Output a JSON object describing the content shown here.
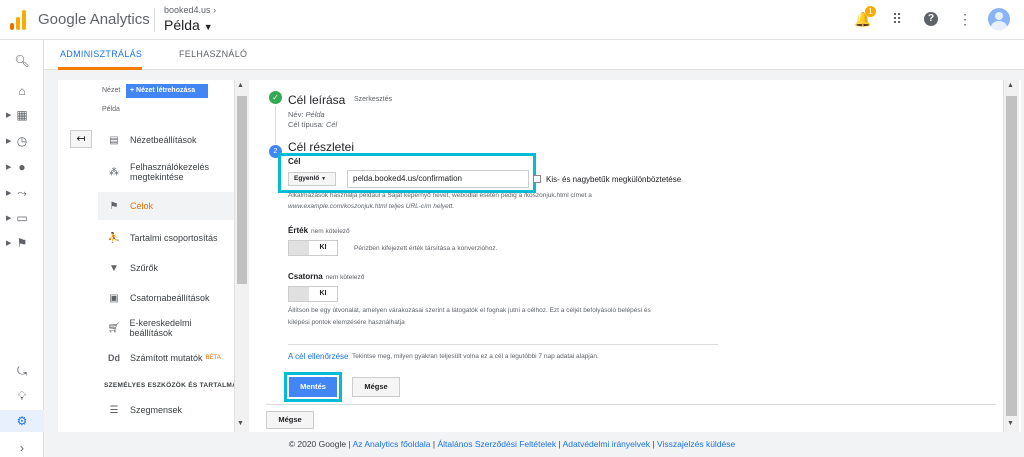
{
  "header": {
    "app_name": "Google Analytics",
    "account_top": "booked4.us",
    "account_main": "Példa",
    "notification_count": "1"
  },
  "rail": {
    "items": [
      "search-icon",
      "home-icon",
      "dashboard-icon",
      "clock-icon",
      "person-icon",
      "acquisition-icon",
      "behavior-icon",
      "flag-icon",
      "share-icon",
      "lightbulb-icon",
      "gear-icon",
      "expand-icon"
    ]
  },
  "tabs": [
    "ADMINISZTRÁLÁS",
    "FELHASZNÁLÓ"
  ],
  "view": {
    "label": "Nézet",
    "create_button": "+ Nézet létrehozása",
    "name": "Példa"
  },
  "sidebar": {
    "items": [
      {
        "label": "Nézetbeállítások",
        "icon": "document-icon"
      },
      {
        "label": "Felhasználókezelés",
        "label2": "megtekintése",
        "icon": "people-icon"
      },
      {
        "label": "Célok",
        "icon": "flag-icon"
      },
      {
        "label": "Tartalmi csoportosítás",
        "icon": "walk-icon"
      },
      {
        "label": "Szűrők",
        "icon": "filter-icon"
      },
      {
        "label": "Csatornabeállítások",
        "icon": "channel-icon"
      },
      {
        "label": "E-kereskedelmi beállítások",
        "icon": "cart-icon"
      },
      {
        "label": "Számított mutatók",
        "beta": "BÉTA",
        "icon": "dd-icon"
      }
    ],
    "section_title": "SZEMÉLYES ESZKÖZÖK ÉS TARTALMAK",
    "section_items": [
      {
        "label": "Szegmensek",
        "icon": "segments-icon"
      }
    ]
  },
  "goal": {
    "step1_title": "Cél leírása",
    "edit_label": "Szerkesztés",
    "name_label": "Név:",
    "name_value": "Példa",
    "type_label": "Cél típusa:",
    "type_value": "Cél",
    "step2_title": "Cél részletei",
    "step2_number": "2",
    "target_label": "Cél",
    "match_type": "Egyenlő",
    "url_value": "pelda.booked4.us/confirmation",
    "case_sensitive_label": "Kis- és nagybetűk megkülönböztetése",
    "help_line1": "Alkalmazások használja például a Saját képernyő nevet, webodlal esetén pedig a /koszonjuk.html címet a",
    "help_line2": "www.example.com/koszonjuk.html teljes URL-cím helyett.",
    "value_label": "Érték",
    "value_optional": "nem kötelező",
    "value_toggle": "KI",
    "value_desc": "Pénzben kifejezett érték társítása a konverzióhoz.",
    "funnel_label": "Csatorna",
    "funnel_optional": "nem kötelező",
    "funnel_toggle": "KI",
    "funnel_desc_line1": "Állítson be egy útvonalat, amelyen várakozásai szerint a látogatók el fognak jutni a célhoz. Ezt a céljét befolyásoló belépési és",
    "funnel_desc_line2": "kilépési pontok elemzésére használhatja",
    "verify_link": "A cél ellenőrzése",
    "verify_desc": "Tekintse meg, milyen gyakran teljesült volna ez a cél a legutóbbi 7 nap adatai alapján.",
    "save_button": "Mentés",
    "cancel_button": "Mégse",
    "cancel_button_bottom": "Mégse"
  },
  "footer": {
    "copyright": "© 2020 Google",
    "sep": "|",
    "links": [
      "Az Analytics főoldala",
      "Általános Szerződési Feltételek",
      "Adatvédelmi irányelvek",
      "Visszajelzés küldése"
    ]
  },
  "colors": {
    "accent_blue": "#4285f4",
    "highlight": "#00bcd4",
    "active_orange": "#e8710a",
    "check_green": "#34a853"
  }
}
